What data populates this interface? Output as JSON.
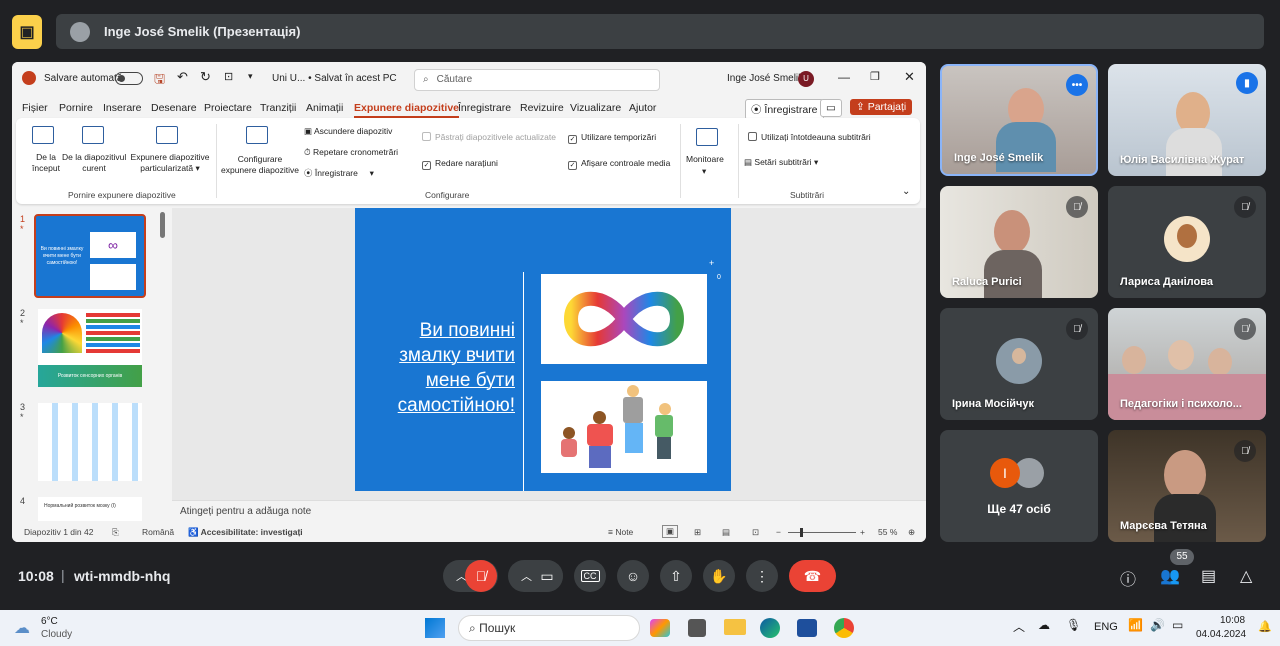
{
  "meet": {
    "presenter_label": "Inge José Smelik (Презентація)",
    "time": "10:08",
    "separator": "|",
    "meeting_code": "wti-mmdb-nhq",
    "participants_badge": "55",
    "more_people": "Ще 47 осіб",
    "more_initial": "I"
  },
  "participants": [
    {
      "name": "Inge José Smelik",
      "speaking": true
    },
    {
      "name": "Юлія Василівна Журат",
      "speaking": true
    },
    {
      "name": "Raluca Purici",
      "muted": true
    },
    {
      "name": "Лариса Данілова",
      "muted": true
    },
    {
      "name": "Ірина Мосійчук",
      "muted": true
    },
    {
      "name": "Педагогіки і психоло...",
      "muted": true
    },
    {
      "name": "Марєєва Тетяна",
      "muted": true
    }
  ],
  "ppt": {
    "autosave": "Salvare automată",
    "filename": "Uni U... • Salvat în acest PC",
    "search_placeholder": "Căutare",
    "user": "Inge José Smelik",
    "user_initial": "U",
    "menu": [
      "Fișier",
      "Pornire",
      "Inserare",
      "Desenare",
      "Proiectare",
      "Tranziții",
      "Animații",
      "Expunere diapozitive",
      "Înregistrare",
      "Revizuire",
      "Vizualizare",
      "Ajutor"
    ],
    "record_btn": "Înregistrare",
    "share_btn": "Partajați",
    "ribbon": {
      "from_start": [
        "De la",
        "început"
      ],
      "from_current": [
        "De la diapozitivul",
        "curent"
      ],
      "custom": [
        "Expunere diapozitive",
        "particularizată"
      ],
      "group1": "Pornire expunere diapozitive",
      "setup": [
        "Configurare",
        "expunere diapozitive"
      ],
      "hide": "Ascundere diapozitiv",
      "rehearse": "Repetare cronometrări",
      "record": "Înregistrare",
      "keep_updated": "Păstrați diapozitivele actualizate",
      "play_narr": "Redare narațiuni",
      "use_timings": "Utilizare temporizări",
      "show_media": "Afișare controale media",
      "group2": "Configurare",
      "monitor": "Monitoare",
      "always_subs": "Utilizați întotdeauna subtitrări",
      "subs_settings": "Setări subtitrări",
      "group3": "Subtitrări"
    },
    "slide_text": "Ви повинні змалку вчити мене бути самостійною!",
    "thumb1_text": "Ви повинні змалку вчити мене бути самостійною!",
    "thumb2_caption": "Розвиток сенсорних органів",
    "thumb4_caption": "Нормальний розвиток мозку (I)",
    "slide_numbers": [
      "1",
      "2",
      "3",
      "4"
    ],
    "star": "*",
    "notes_placeholder": "Atingeți pentru a adăuga note",
    "status_slide": "Diapozitiv 1 din 42",
    "status_lang": "Română",
    "status_access": "Accesibilitate: investigați",
    "status_notes": "Note",
    "zoom": "55 %",
    "plus_marker": "+",
    "zero_marker": "0"
  },
  "taskbar": {
    "temp": "6°C",
    "weather": "Cloudy",
    "search": "Пошук",
    "lang": "ENG",
    "clock": "10:08",
    "date": "04.04.2024"
  }
}
